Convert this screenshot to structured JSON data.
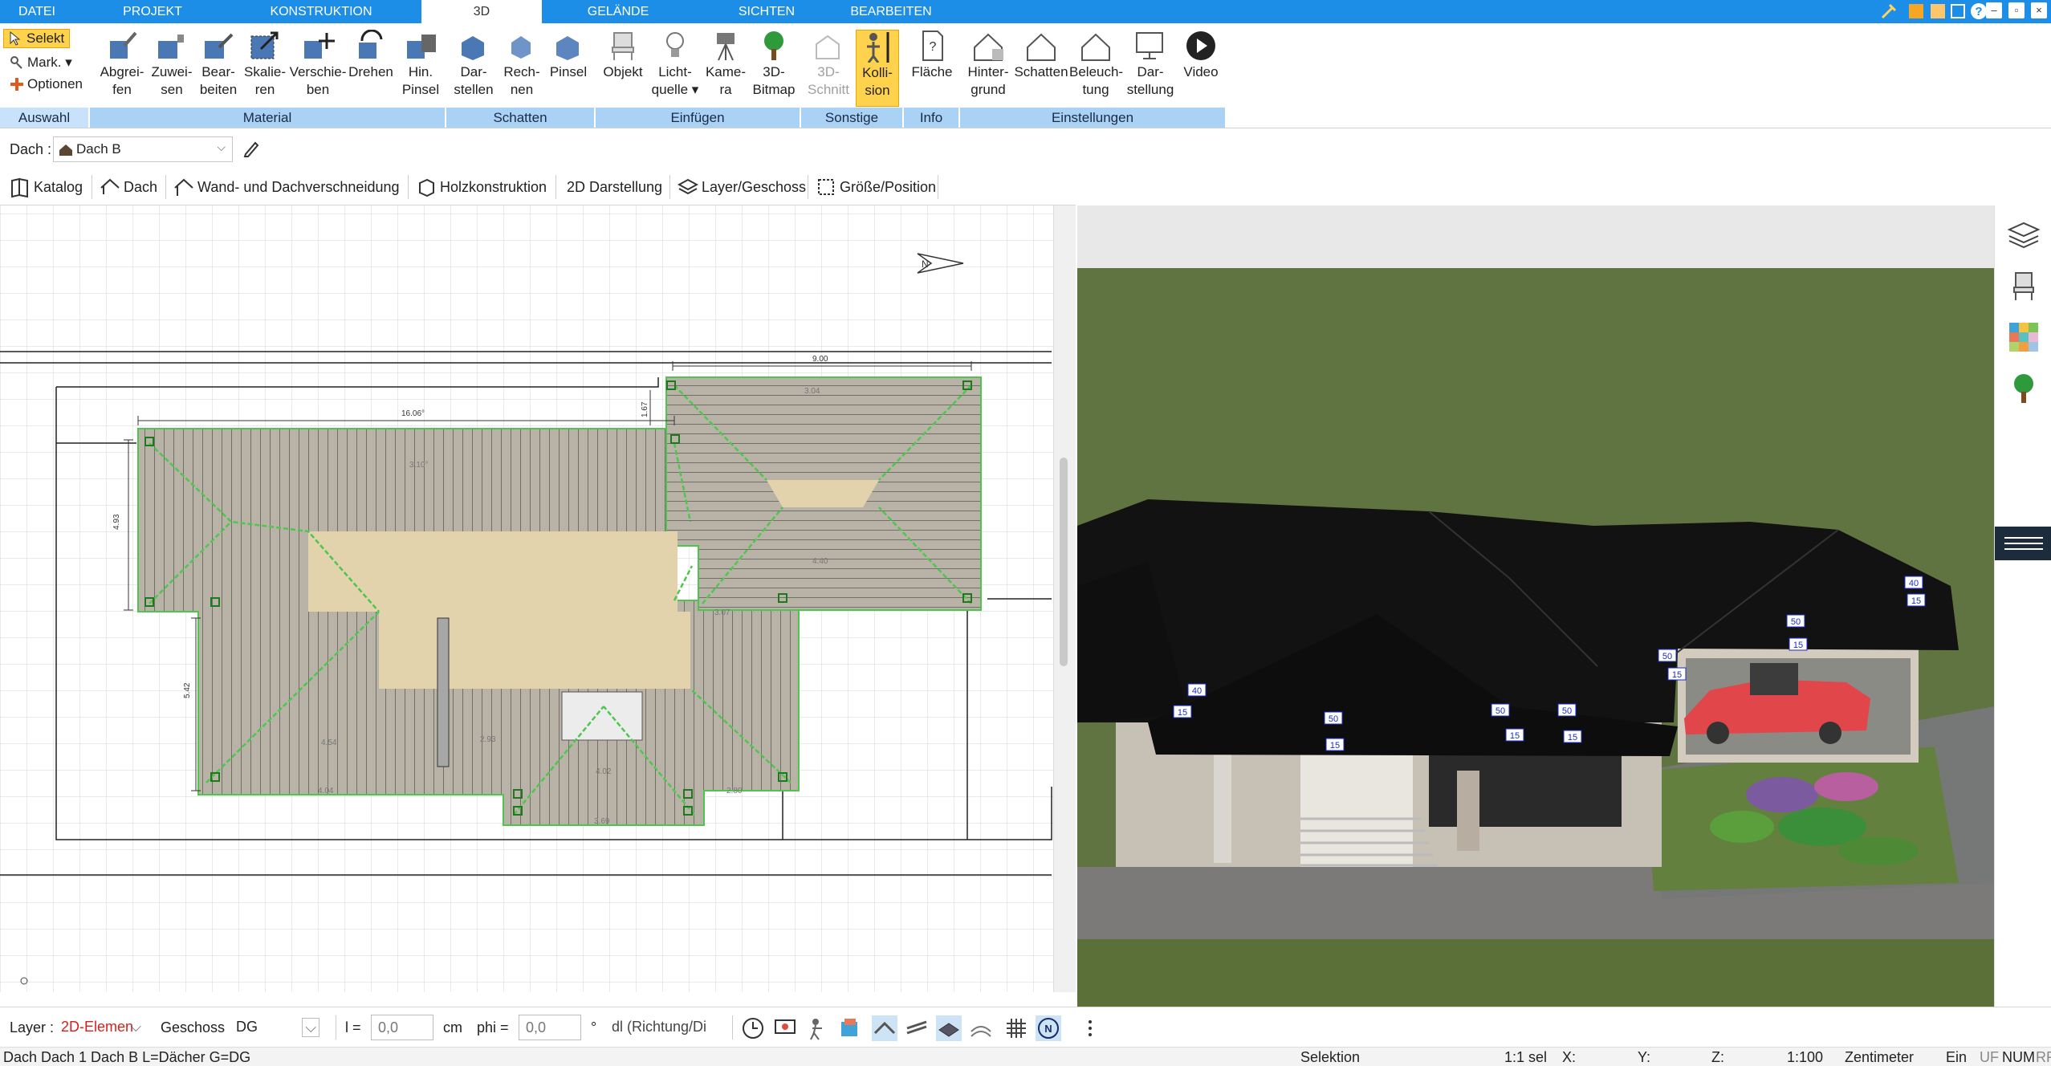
{
  "menu": {
    "tabs": [
      "DATEI",
      "PROJEKT",
      "KONSTRUKTION",
      "3D",
      "GELÄNDE",
      "SICHTEN",
      "BEARBEITEN"
    ],
    "active_tab": "3D"
  },
  "ribbon": {
    "auswahl": {
      "select": "Selekt",
      "mark": "Mark.",
      "options": "Optionen",
      "label": "Auswahl"
    },
    "material": {
      "buttons": [
        {
          "l1": "Abgrei-",
          "l2": "fen"
        },
        {
          "l1": "Zuwei-",
          "l2": "sen"
        },
        {
          "l1": "Bear-",
          "l2": "beiten"
        },
        {
          "l1": "Skalie-",
          "l2": "ren"
        },
        {
          "l1": "Verschie-",
          "l2": "ben"
        },
        {
          "l1": "Drehen",
          "l2": ""
        },
        {
          "l1": "Hin.",
          "l2": "Pinsel"
        }
      ],
      "label": "Material"
    },
    "schatten": {
      "buttons": [
        {
          "l1": "Dar-",
          "l2": "stellen"
        },
        {
          "l1": "Rech-",
          "l2": "nen"
        },
        {
          "l1": "Pinsel",
          "l2": ""
        }
      ],
      "label": "Schatten"
    },
    "einfuegen": {
      "buttons": [
        {
          "l1": "Objekt",
          "l2": ""
        },
        {
          "l1": "Licht-",
          "l2": "quelle"
        },
        {
          "l1": "Kame-",
          "l2": "ra"
        },
        {
          "l1": "3D-",
          "l2": "Bitmap"
        }
      ],
      "label": "Einfügen"
    },
    "sonstige": {
      "buttons": [
        {
          "l1": "3D-",
          "l2": "Schnitt"
        },
        {
          "l1": "Kolli-",
          "l2": "sion"
        }
      ],
      "label": "Sonstige"
    },
    "info": {
      "buttons": [
        {
          "l1": "Fläche",
          "l2": ""
        }
      ],
      "label": "Info"
    },
    "einstellungen": {
      "buttons": [
        {
          "l1": "Hinter-",
          "l2": "grund"
        },
        {
          "l1": "Schatten",
          "l2": ""
        },
        {
          "l1": "Beleuch-",
          "l2": "tung"
        },
        {
          "l1": "Dar-",
          "l2": "stellung"
        },
        {
          "l1": "Video",
          "l2": ""
        }
      ],
      "label": "Einstellungen"
    }
  },
  "roofbar": {
    "label": "Dach :",
    "value": "Dach B"
  },
  "toolbar2": [
    "Katalog",
    "Dach",
    "Wand- und Dachverschneidung",
    "Holzkonstruktion",
    "2D Darstellung",
    "Layer/Geschoss",
    "Größe/Position"
  ],
  "plan": {
    "dimensions": {
      "top_right": "9.00",
      "top_left": "16.06°",
      "left_a": "4.93",
      "left_b": "5.42",
      "mid_1": "1.67",
      "inner_1": "3.10°",
      "inner_2": "4.40",
      "inner_3": "3.07",
      "inner_4": "4.54",
      "inner_5": "2.93",
      "inner_6": "4.04",
      "inner_7": "3.04",
      "inner_8": "2.80",
      "inner_9": "4.02",
      "inner_10": "3.69"
    },
    "north_label": "N"
  },
  "view3d": {
    "labels": [
      "40",
      "15",
      "50",
      "15",
      "50",
      "15",
      "50",
      "15",
      "50",
      "15",
      "50",
      "15",
      "40",
      "15"
    ]
  },
  "bottom": {
    "layer_label": "Layer :",
    "layer_value": "2D-Elemen",
    "geschoss_label": "Geschoss :",
    "geschoss_value": "DG",
    "l_label": "l =",
    "l_value": "0,0",
    "l_unit": "cm",
    "phi_label": "phi =",
    "phi_value": "0,0",
    "phi_unit": "°",
    "mode_value": "dl (Richtung/Di"
  },
  "status": {
    "left": "Dach Dach 1 Dach B L=Dächer G=DG",
    "mode": "Selektion",
    "sel": "1:1 sel",
    "x": "X:",
    "y": "Y:",
    "z": "Z:",
    "scale": "1:100",
    "unit": "Zentimeter",
    "ein": "Ein",
    "uf": "UF",
    "num": "NUM",
    "rf": "RF"
  },
  "colors": {
    "menubar": "#1c8ee8",
    "group_label": "#a9d2f5",
    "selected": "#ffd24d",
    "roof_green": "#4ec64e",
    "layer_red": "#d42020"
  }
}
